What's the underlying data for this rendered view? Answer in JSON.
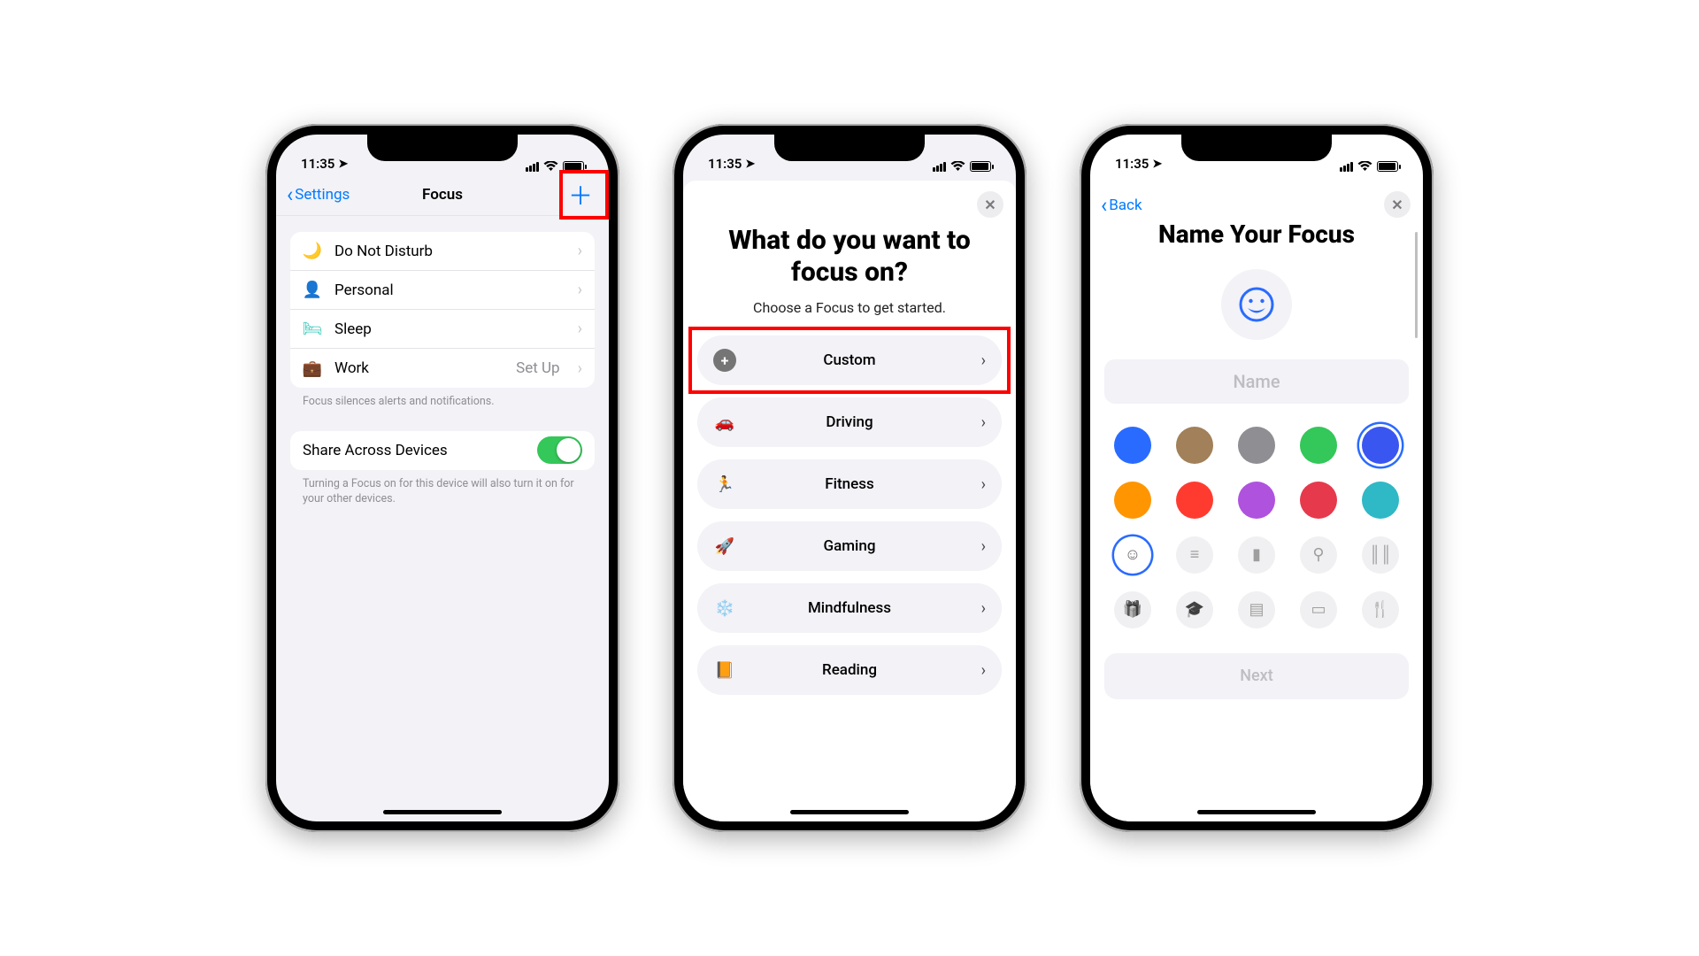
{
  "status": {
    "time": "11:35",
    "wifi": true,
    "battery": 90
  },
  "screen1": {
    "back_label": "Settings",
    "title": "Focus",
    "focusItems": [
      {
        "icon": "🌙",
        "label": "Do Not Disturb",
        "detail": "",
        "icon_name": "moon-icon",
        "color": "#5856d6"
      },
      {
        "icon": "👤",
        "label": "Personal",
        "detail": "",
        "icon_name": "person-icon",
        "color": "#a156d6"
      },
      {
        "icon": "🛏",
        "label": "Sleep",
        "detail": "",
        "icon_name": "bed-icon",
        "color": "#34c7b8"
      },
      {
        "icon": "💼",
        "label": "Work",
        "detail": "Set Up",
        "icon_name": "briefcase-icon",
        "color": "#5ab9e6"
      }
    ],
    "hint1": "Focus silences alerts and notifications.",
    "share_label": "Share Across Devices",
    "share_on": true,
    "hint2": "Turning a Focus on for this device will also turn it on for your other devices."
  },
  "screen2": {
    "title": "What do you want to focus on?",
    "subtitle": "Choose a Focus to get started.",
    "options": [
      {
        "icon": "+",
        "label": "Custom",
        "icon_name": "plus-circle-icon",
        "circle": true,
        "color": "#757575",
        "highlight": true
      },
      {
        "icon": "🚗",
        "label": "Driving",
        "icon_name": "car-icon",
        "color": "#2a6bff"
      },
      {
        "icon": "🏃",
        "label": "Fitness",
        "icon_name": "running-icon",
        "color": "#34c759"
      },
      {
        "icon": "🚀",
        "label": "Gaming",
        "icon_name": "rocket-icon",
        "color": "#2a6bff"
      },
      {
        "icon": "❄️",
        "label": "Mindfulness",
        "icon_name": "mindfulness-icon",
        "color": "#5ac8fa"
      },
      {
        "icon": "📙",
        "label": "Reading",
        "icon_name": "book-icon",
        "color": "#ff9500"
      }
    ]
  },
  "screen3": {
    "back_label": "Back",
    "title": "Name Your Focus",
    "name_placeholder": "Name",
    "next_label": "Next",
    "preview_icon_name": "smiley-icon",
    "colors": [
      {
        "hex": "#2a6bff",
        "selected": false
      },
      {
        "hex": "#a1805a",
        "selected": false
      },
      {
        "hex": "#8e8e93",
        "selected": false
      },
      {
        "hex": "#34c759",
        "selected": false
      },
      {
        "hex": "#3a56f0",
        "selected": true
      },
      {
        "hex": "#ff9500",
        "selected": false
      },
      {
        "hex": "#ff3b30",
        "selected": false
      },
      {
        "hex": "#af52de",
        "selected": false
      },
      {
        "hex": "#e6394b",
        "selected": false
      },
      {
        "hex": "#2fb8c6",
        "selected": false
      }
    ],
    "icons": [
      {
        "name": "smiley-icon",
        "glyph": "☺",
        "selected": true
      },
      {
        "name": "list-icon",
        "glyph": "≡",
        "selected": false
      },
      {
        "name": "bookmark-icon",
        "glyph": "▮",
        "selected": false
      },
      {
        "name": "key-icon",
        "glyph": "⚲",
        "selected": false
      },
      {
        "name": "library-icon",
        "glyph": "║║",
        "selected": false
      },
      {
        "name": "gift-icon",
        "glyph": "🎁",
        "selected": false
      },
      {
        "name": "grad-cap-icon",
        "glyph": "🎓",
        "selected": false
      },
      {
        "name": "file-icon",
        "glyph": "▤",
        "selected": false
      },
      {
        "name": "card-icon",
        "glyph": "▭",
        "selected": false
      },
      {
        "name": "fork-icon",
        "glyph": "🍴",
        "selected": false
      }
    ]
  }
}
